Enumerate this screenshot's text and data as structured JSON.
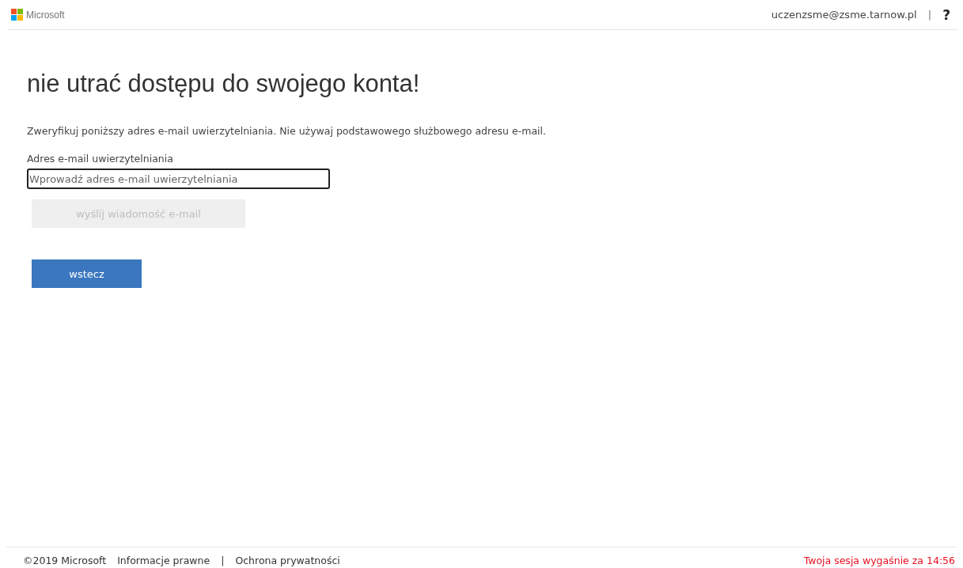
{
  "header": {
    "logo_text": "Microsoft",
    "account": "uczenzsme@zsme.tarnow.pl",
    "separator": "|",
    "help": "?"
  },
  "title": "nie utrać dostępu do swojego konta!",
  "description": "Zweryfikuj poniższy adres e-mail uwierzytelniania. Nie używaj podstawowego służbowego adresu e-mail.",
  "field": {
    "label": "Adres e-mail uwierzytelniania",
    "placeholder": "Wprowadź adres e-mail uwierzytelniania"
  },
  "buttons": [
    {
      "label": "wyślij wiadomość e-mail",
      "disabled": true
    },
    {
      "label": "wstecz",
      "disabled": false
    }
  ],
  "footer": {
    "copyright": "©2019 Microsoft",
    "links": [
      "Informacje prawne",
      "Ochrona prywatności"
    ],
    "separator": "|",
    "session": "Twoja sesja wygaśnie za 14:56"
  }
}
